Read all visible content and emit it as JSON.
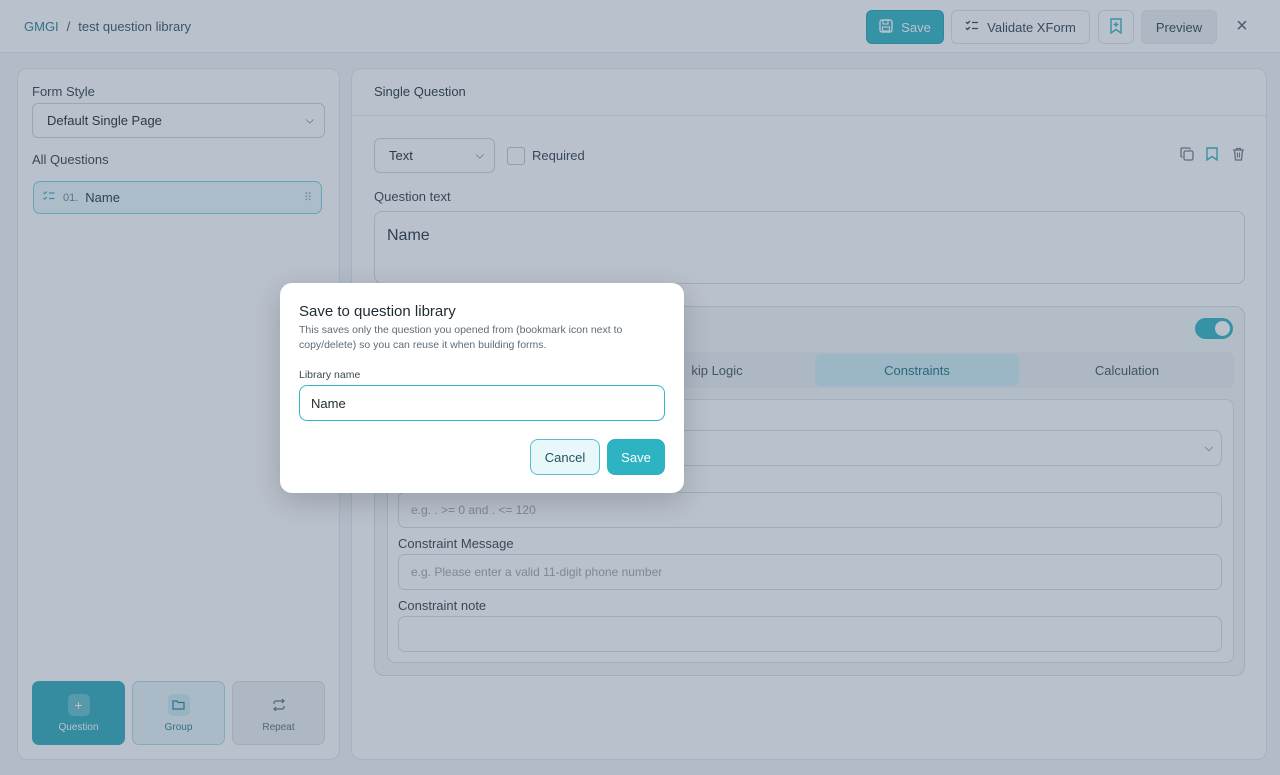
{
  "breadcrumb": {
    "root": "GMGI",
    "separator": "/",
    "current": "test question library"
  },
  "toolbar": {
    "save_label": "Save",
    "validate_label": "Validate XForm",
    "preview_label": "Preview"
  },
  "left": {
    "form_style_label": "Form Style",
    "form_style_value": "Default Single Page",
    "all_questions_label": "All Questions",
    "questions": [
      {
        "number": "01.",
        "name": "Name"
      }
    ],
    "add_buttons": {
      "question": "Question",
      "group": "Group",
      "repeat": "Repeat"
    }
  },
  "editor": {
    "title": "Single Question",
    "type_value": "Text",
    "required_label": "Required",
    "question_text_label": "Question text",
    "question_text_value": "Name",
    "tabs": [
      "kip Logic",
      "Constraints",
      "Calculation"
    ],
    "active_tab": "Constraints",
    "constraint_placeholder": "e.g. . >= 0 and . <= 120",
    "constraint_message_label": "Constraint Message",
    "constraint_message_placeholder": "e.g. Please enter a valid 11-digit phone number",
    "constraint_note_label": "Constraint note"
  },
  "modal": {
    "title": "Save to question library",
    "description": "This saves only the question you opened from (bookmark icon next to copy/delete) so you can reuse it when building forms.",
    "library_name_label": "Library name",
    "library_name_value": "Name",
    "cancel_label": "Cancel",
    "save_label": "Save"
  },
  "colors": {
    "accent": "#2db3c1",
    "overlay": "#465c78"
  },
  "icons": {
    "save": "floppy-disk-icon",
    "validate": "checklist-icon",
    "bookmark": "bookmark-plus-icon",
    "close": "close-icon",
    "copy": "copy-icon",
    "save_to_library": "bookmark-icon",
    "delete": "trash-icon"
  }
}
